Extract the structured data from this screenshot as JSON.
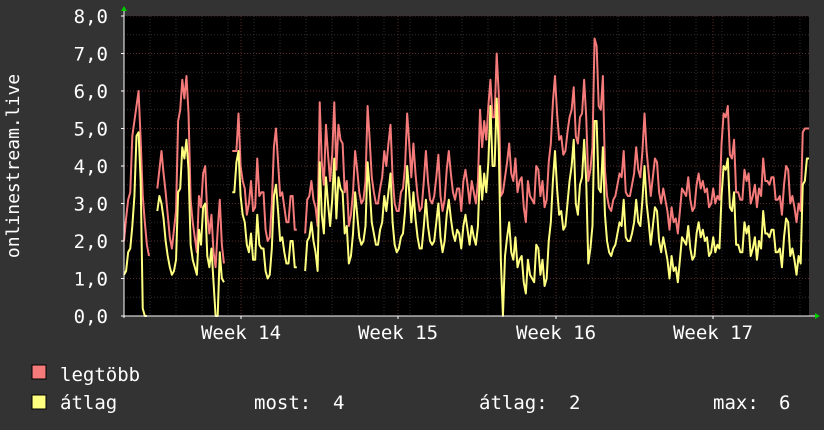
{
  "chart_data": {
    "type": "line",
    "ylabel": "onlinestream.live",
    "ylim": [
      0,
      8
    ],
    "y_ticks": [
      "0,0",
      "1,0",
      "2,0",
      "3,0",
      "4,0",
      "5,0",
      "6,0",
      "7,0",
      "8,0"
    ],
    "x_ticks": [
      "Week 14",
      "Week 15",
      "Week 16",
      "Week 17"
    ],
    "grid": true,
    "colors": {
      "background": "#333333",
      "plot_background": "#000000",
      "grid_minor": "#2e2e2e",
      "grid_major": "#5a2a2a",
      "axis": "#ffffff",
      "legend_text": "#ffffff"
    },
    "series": [
      {
        "name": "legtöbb",
        "color": "#f57a7a",
        "values": [
          2.0,
          2.6,
          3.1,
          3.3,
          4.8,
          5.2,
          5.6,
          6.0,
          4.7,
          3.2,
          2.5,
          1.9,
          1.6,
          null,
          null,
          null,
          3.4,
          3.9,
          4.4,
          3.8,
          3.3,
          2.7,
          2.1,
          1.8,
          2.3,
          2.8,
          5.2,
          5.5,
          6.3,
          5.8,
          6.4,
          5.4,
          3.1,
          2.5,
          2.1,
          1.7,
          3.2,
          2.9,
          3.8,
          4.0,
          2.7,
          2.2,
          2.7,
          1.7,
          1.3,
          2.3,
          3.1,
          1.9,
          1.4,
          null,
          null,
          null,
          4.4,
          4.4,
          4.4,
          5.4,
          4.0,
          3.6,
          3.4,
          2.7,
          3.0,
          3.6,
          2.8,
          2.9,
          4.2,
          3.2,
          3.3,
          3.3,
          2.3,
          2.0,
          2.1,
          3.0,
          4.5,
          5.0,
          4.1,
          3.2,
          3.3,
          2.9,
          2.5,
          2.5,
          3.2,
          3.2,
          2.3,
          2.3,
          null,
          null,
          null,
          2.2,
          3.1,
          3.2,
          3.6,
          3.1,
          2.9,
          2.4,
          5.7,
          4.1,
          3.5,
          5.1,
          4.3,
          3.6,
          4.3,
          5.7,
          3.9,
          5.1,
          4.7,
          4.6,
          3.3,
          3.6,
          2.4,
          2.7,
          3.3,
          4.4,
          3.9,
          3.3,
          3.0,
          3.1,
          3.6,
          5.6,
          4.7,
          3.7,
          3.3,
          3.0,
          3.0,
          3.4,
          3.7,
          4.4,
          4.0,
          4.6,
          5.1,
          3.7,
          3.0,
          2.8,
          2.8,
          3.3,
          3.4,
          4.0,
          5.4,
          4.6,
          3.7,
          4.6,
          3.8,
          3.2,
          2.8,
          2.9,
          3.6,
          4.4,
          3.6,
          3.1,
          3.0,
          3.2,
          3.7,
          4.3,
          3.2,
          2.8,
          3.1,
          3.9,
          4.4,
          3.8,
          3.3,
          3.1,
          3.4,
          3.4,
          2.8,
          3.6,
          3.9,
          3.5,
          3.0,
          3.6,
          3.3,
          3.0,
          3.6,
          5.5,
          4.5,
          5.2,
          4.7,
          5.6,
          6.3,
          5.3,
          5.3,
          7.0,
          5.9,
          3.2,
          3.3,
          3.7,
          4.1,
          4.6,
          3.8,
          3.6,
          4.2,
          3.3,
          3.6,
          3.7,
          2.9,
          2.5,
          3.6,
          3.2,
          3.1,
          3.0,
          4.0,
          3.9,
          3.2,
          3.6,
          2.9,
          3.1,
          4.1,
          4.6,
          5.7,
          6.4,
          5.4,
          4.7,
          4.8,
          4.3,
          4.4,
          4.9,
          5.3,
          5.5,
          6.1,
          4.8,
          4.6,
          5.3,
          5.4,
          6.3,
          5.3,
          3.6,
          3.9,
          4.5,
          7.4,
          7.2,
          5.6,
          5.5,
          6.4,
          3.9,
          3.2,
          2.9,
          2.8,
          3.1,
          3.2,
          3.5,
          3.8,
          3.7,
          4.4,
          3.3,
          3.2,
          3.2,
          3.5,
          3.8,
          4.5,
          3.9,
          3.7,
          4.4,
          5.4,
          4.4,
          3.8,
          3.2,
          3.7,
          4.2,
          4.1,
          3.3,
          3.0,
          3.4,
          3.1,
          2.8,
          2.3,
          2.9,
          2.5,
          2.6,
          2.2,
          2.8,
          3.4,
          3.3,
          3.2,
          3.7,
          3.1,
          2.8,
          2.9,
          3.5,
          3.8,
          3.4,
          3.6,
          3.3,
          3.4,
          2.9,
          3.0,
          3.4,
          3.0,
          3.2,
          3.1,
          4.6,
          5.4,
          5.3,
          5.6,
          4.3,
          4.2,
          4.7,
          3.3,
          3.3,
          3.1,
          3.1,
          3.9,
          3.6,
          3.8,
          3.0,
          3.2,
          3.5,
          2.9,
          3.4,
          3.2,
          4.2,
          3.6,
          3.6,
          3.5,
          3.7,
          3.7,
          3.1,
          3.1,
          3.2,
          2.7,
          3.5,
          4.0,
          3.9,
          3.0,
          3.2,
          2.9,
          2.5,
          3.0,
          2.8,
          4.9,
          5.0,
          5.0,
          5.0
        ]
      },
      {
        "name": "átlag",
        "color": "#ffff80",
        "values": [
          1.1,
          1.2,
          1.7,
          1.8,
          2.4,
          3.2,
          4.8,
          4.9,
          3.6,
          0.2,
          0.0,
          0.0,
          null,
          null,
          null,
          null,
          2.8,
          3.2,
          3.0,
          2.6,
          2.0,
          1.6,
          1.3,
          1.1,
          1.2,
          1.5,
          3.3,
          3.4,
          4.5,
          4.2,
          4.7,
          3.9,
          1.9,
          1.5,
          1.3,
          1.1,
          2.3,
          1.9,
          2.9,
          3.0,
          1.6,
          1.3,
          1.8,
          0.9,
          0.0,
          0.0,
          1.7,
          1.0,
          0.9,
          null,
          null,
          null,
          3.3,
          3.3,
          4.1,
          4.4,
          3.2,
          2.7,
          2.5,
          1.9,
          1.7,
          2.2,
          1.5,
          1.5,
          2.7,
          1.9,
          1.8,
          1.8,
          1.2,
          1.0,
          1.1,
          1.8,
          3.2,
          3.5,
          2.8,
          2.0,
          2.1,
          1.7,
          1.4,
          1.4,
          2.0,
          2.0,
          1.3,
          1.3,
          null,
          null,
          null,
          1.2,
          2.0,
          2.1,
          2.5,
          2.0,
          1.7,
          1.2,
          4.1,
          2.7,
          2.2,
          3.7,
          3.0,
          2.4,
          3.1,
          4.2,
          2.6,
          3.7,
          3.4,
          3.3,
          2.2,
          2.4,
          1.4,
          1.6,
          2.2,
          3.3,
          2.7,
          2.1,
          1.9,
          2.0,
          2.4,
          4.1,
          3.4,
          2.5,
          2.2,
          1.9,
          1.9,
          2.3,
          2.5,
          3.2,
          2.8,
          3.3,
          3.8,
          2.5,
          1.9,
          1.7,
          1.8,
          2.1,
          2.2,
          2.8,
          4.0,
          3.3,
          2.5,
          3.3,
          2.6,
          2.1,
          1.8,
          1.8,
          2.4,
          3.1,
          2.4,
          2.0,
          1.9,
          2.0,
          2.5,
          3.0,
          2.1,
          1.7,
          2.0,
          2.7,
          3.1,
          2.6,
          2.2,
          2.0,
          2.3,
          2.2,
          1.8,
          2.4,
          2.7,
          2.3,
          1.9,
          2.4,
          2.1,
          1.9,
          2.4,
          4.0,
          3.1,
          3.8,
          3.3,
          4.1,
          5.6,
          4.0,
          4.0,
          5.8,
          4.5,
          1.5,
          0.0,
          1.6,
          2.1,
          2.5,
          1.7,
          1.5,
          2.1,
          1.3,
          1.5,
          1.6,
          0.9,
          0.6,
          1.5,
          1.1,
          1.0,
          0.9,
          1.9,
          1.8,
          1.1,
          1.5,
          0.8,
          1.0,
          2.0,
          2.5,
          3.6,
          4.4,
          3.4,
          2.7,
          2.8,
          2.3,
          2.4,
          3.0,
          3.6,
          4.0,
          4.7,
          3.0,
          2.7,
          3.5,
          3.7,
          4.7,
          3.6,
          1.4,
          1.8,
          2.4,
          5.2,
          5.2,
          3.4,
          3.3,
          4.5,
          2.7,
          2.0,
          1.7,
          1.6,
          1.8,
          1.9,
          2.2,
          2.5,
          2.4,
          3.1,
          2.1,
          2.0,
          2.0,
          2.2,
          2.5,
          3.1,
          2.5,
          2.4,
          3.1,
          4.0,
          3.0,
          2.5,
          1.9,
          2.4,
          2.9,
          2.8,
          2.0,
          1.7,
          2.1,
          1.8,
          1.5,
          1.0,
          1.6,
          1.2,
          1.3,
          0.9,
          1.5,
          2.1,
          2.0,
          1.9,
          2.4,
          1.8,
          1.5,
          1.6,
          2.2,
          2.5,
          2.1,
          2.3,
          2.0,
          2.1,
          1.6,
          1.7,
          2.1,
          1.7,
          1.9,
          1.8,
          3.2,
          4.0,
          3.9,
          4.2,
          2.9,
          2.8,
          3.3,
          1.9,
          1.9,
          1.7,
          1.7,
          2.5,
          2.2,
          2.4,
          1.6,
          1.8,
          2.1,
          1.5,
          2.0,
          1.8,
          2.8,
          2.2,
          2.2,
          2.1,
          2.3,
          2.3,
          1.7,
          1.7,
          1.8,
          1.3,
          2.1,
          2.6,
          2.5,
          1.6,
          1.8,
          1.5,
          1.1,
          1.6,
          1.4,
          3.5,
          3.6,
          4.2,
          4.2
        ]
      }
    ],
    "legend": {
      "position": "bottom-left",
      "items": [
        {
          "label": "legtöbb",
          "color": "#f57a7a"
        },
        {
          "label": "átlag",
          "color": "#ffff80"
        }
      ],
      "stats": {
        "most_label": "most:",
        "most_value": "4",
        "avg_label": "átlag:",
        "avg_value": "2",
        "max_label": "max:",
        "max_value": "6"
      }
    }
  }
}
